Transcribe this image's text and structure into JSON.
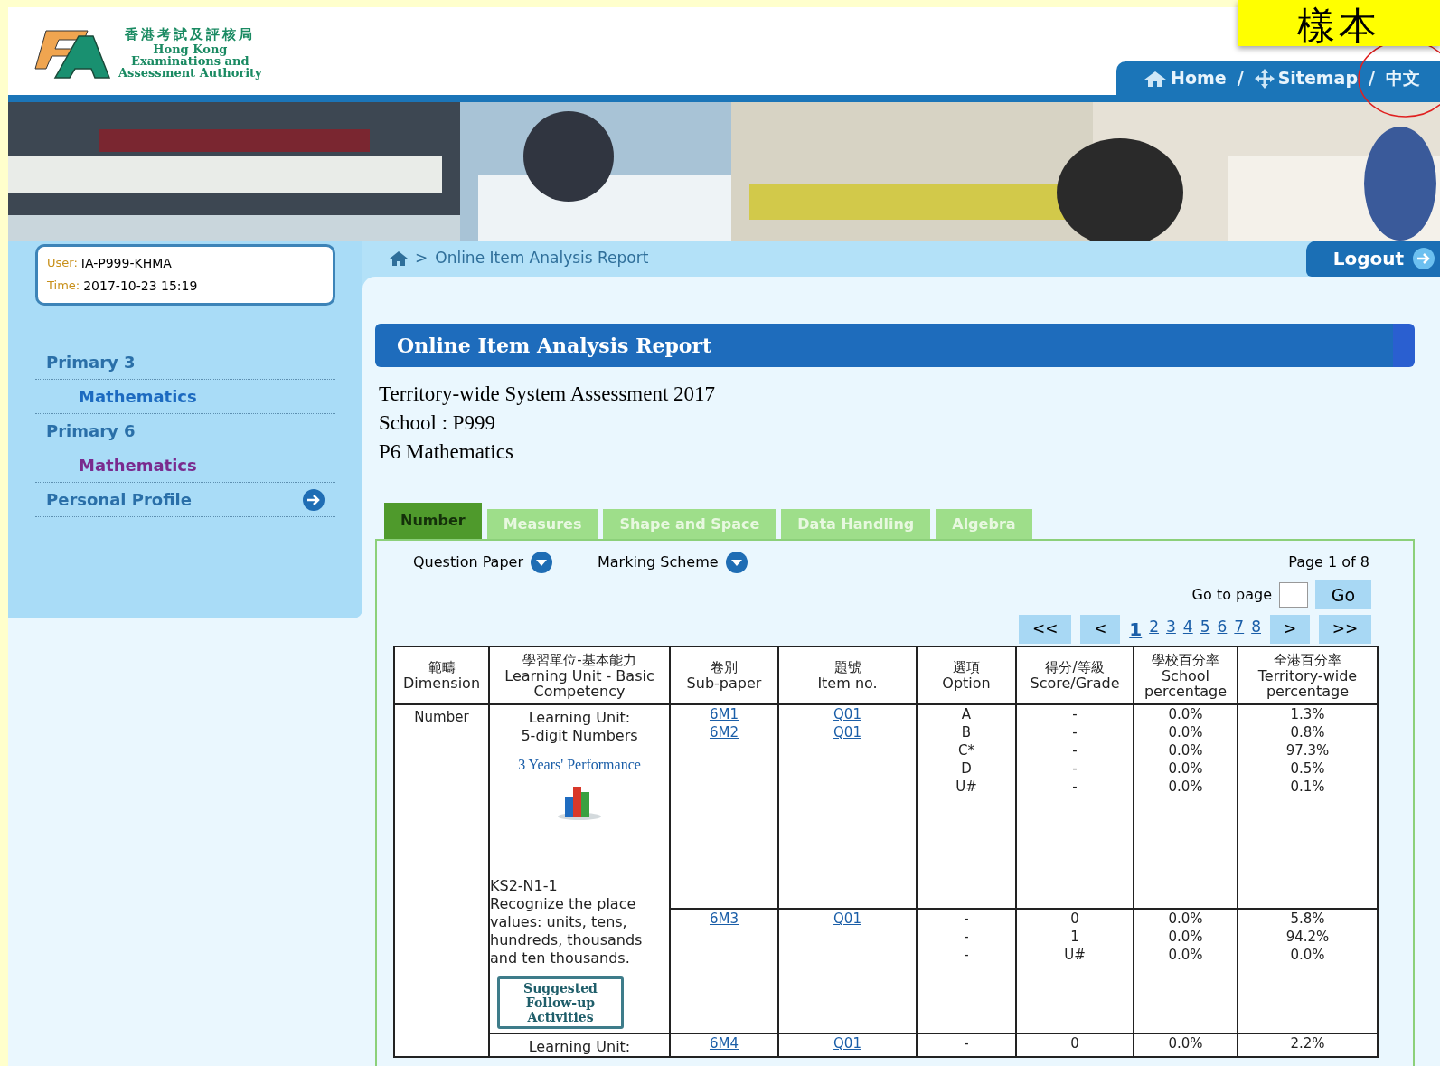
{
  "header": {
    "logo": {
      "chinese": "香港考試及評核局",
      "lines": [
        "Hong Kong",
        "Examinations and",
        "Assessment Authority"
      ]
    },
    "stamp": "樣本",
    "nav": [
      {
        "kind": "home",
        "label": "Home"
      },
      {
        "kind": "separator",
        "label": "/"
      },
      {
        "kind": "sitemap",
        "label": "Sitemap"
      },
      {
        "kind": "separator",
        "label": "/"
      },
      {
        "kind": "language",
        "label": "中文",
        "circled": true
      }
    ]
  },
  "user_box": {
    "user_label": "User:",
    "user": "IA-P999-KHMA",
    "time_label": "Time:",
    "time": "2017-10-23 15:19"
  },
  "sidebar": {
    "items": [
      {
        "label": "Primary 3",
        "children": [
          {
            "label": "Mathematics",
            "selected": false
          }
        ]
      },
      {
        "label": "Primary 6",
        "children": [
          {
            "label": "Mathematics",
            "selected": true
          }
        ]
      },
      {
        "label": "Personal Profile",
        "arrow": true
      }
    ]
  },
  "breadcrumb": {
    "separator": ">",
    "label": "Online Item Analysis Report"
  },
  "logout": "Logout",
  "report": {
    "title": "Online Item Analysis Report",
    "info": [
      "Territory-wide System Assessment 2017",
      "School : P999",
      "P6 Mathematics"
    ],
    "tabs": [
      {
        "label": "Number",
        "selected": true
      },
      {
        "label": "Measures",
        "selected": false
      },
      {
        "label": "Shape and Space",
        "selected": false
      },
      {
        "label": "Data Handling",
        "selected": false
      },
      {
        "label": "Algebra",
        "selected": false
      }
    ],
    "downloads": [
      "Question Paper",
      "Marking Scheme"
    ],
    "page_info": "Page 1 of 8",
    "goto_label": "Go to page",
    "go": "Go",
    "pager": {
      "first": "<<",
      "prev": "<",
      "pages": [
        {
          "label": "1",
          "selected": true
        },
        {
          "label": "2",
          "selected": false
        },
        {
          "label": "3",
          "selected": false
        },
        {
          "label": "4",
          "selected": false
        },
        {
          "label": "5",
          "selected": false
        },
        {
          "label": "6",
          "selected": false
        },
        {
          "label": "7",
          "selected": false
        },
        {
          "label": "8",
          "selected": false
        }
      ],
      "next": ">",
      "last": ">>"
    },
    "table": {
      "columns": [
        {
          "zh": "範疇",
          "en": "Dimension"
        },
        {
          "zh": "學習單位-基本能力",
          "en": "Learning Unit - Basic Competency"
        },
        {
          "zh": "卷別",
          "en": "Sub-paper"
        },
        {
          "zh": "題號",
          "en": "Item no."
        },
        {
          "zh": "選項",
          "en": "Option"
        },
        {
          "zh": "得分/等級",
          "en": "Score/Grade"
        },
        {
          "zh": "學校百分率",
          "en": "School percentage"
        },
        {
          "zh": "全港百分率",
          "en": "Territory-wide percentage"
        }
      ],
      "dimension": "Number",
      "units": [
        {
          "title": [
            "Learning Unit:",
            "5-digit Numbers"
          ],
          "performance_link": "3 Years' Performance",
          "code": "KS2-N1-1",
          "description": "Recognize the place values: units, tens, hundreds, thousands and ten thousands.",
          "followup": "Suggested Follow-up Activities",
          "rows": [
            {
              "subpapers": [
                "6M1",
                "6M2"
              ],
              "items": [
                "Q01",
                "Q01"
              ],
              "options": [
                "A",
                "B",
                "C*",
                "D",
                "U#"
              ],
              "scores": [
                "-",
                "-",
                "-",
                "-",
                "-"
              ],
              "school": [
                "0.0%",
                "0.0%",
                "0.0%",
                "0.0%",
                "0.0%"
              ],
              "territory": [
                "1.3%",
                "0.8%",
                "97.3%",
                "0.5%",
                "0.1%"
              ]
            },
            {
              "subpapers": [
                "6M3"
              ],
              "items": [
                "Q01"
              ],
              "options": [
                "-",
                "-",
                "-"
              ],
              "scores": [
                "0",
                "1",
                "U#"
              ],
              "school": [
                "0.0%",
                "0.0%",
                "0.0%"
              ],
              "territory": [
                "5.8%",
                "94.2%",
                "0.0%"
              ]
            }
          ]
        },
        {
          "title": [
            "Learning Unit:"
          ],
          "rows": [
            {
              "subpapers": [
                "6M4"
              ],
              "items": [
                "Q01"
              ],
              "options": [
                "-"
              ],
              "scores": [
                "0"
              ],
              "school": [
                "0.0%"
              ],
              "territory": [
                "2.2%"
              ]
            }
          ]
        }
      ]
    }
  }
}
